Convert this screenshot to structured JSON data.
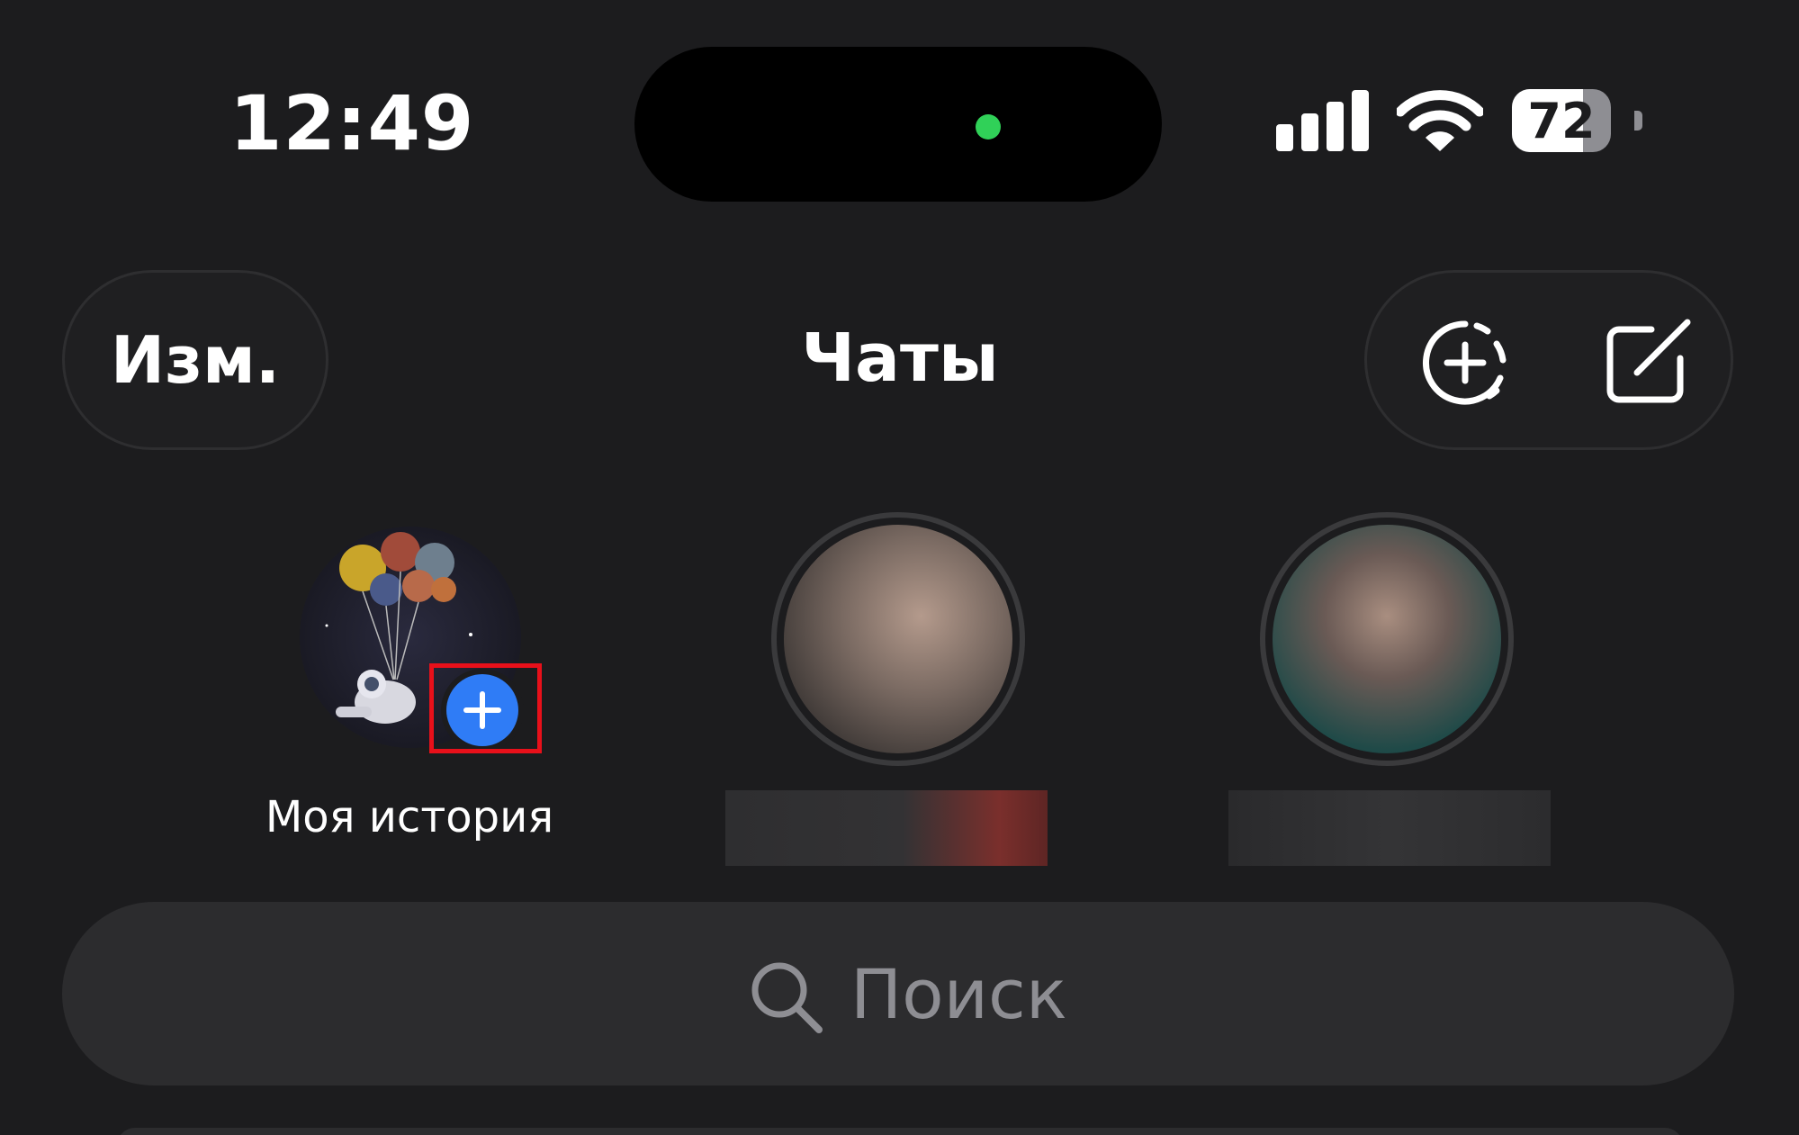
{
  "status_bar": {
    "time": "12:49",
    "battery_percent": "72",
    "battery_level": 0.72,
    "signal_bars": 4,
    "camera_indicator_color": "#30d158"
  },
  "nav": {
    "edit_label": "Изм.",
    "title": "Чаты",
    "new_story_icon": "add-story-icon",
    "compose_icon": "compose-icon"
  },
  "stories": {
    "my_story_label": "Моя история",
    "add_badge_color": "#2f7cf6",
    "highlight_color": "#e8101a"
  },
  "search": {
    "placeholder": "Поиск"
  },
  "colors": {
    "background": "#1c1c1e",
    "accent": "#2f7cf6"
  }
}
